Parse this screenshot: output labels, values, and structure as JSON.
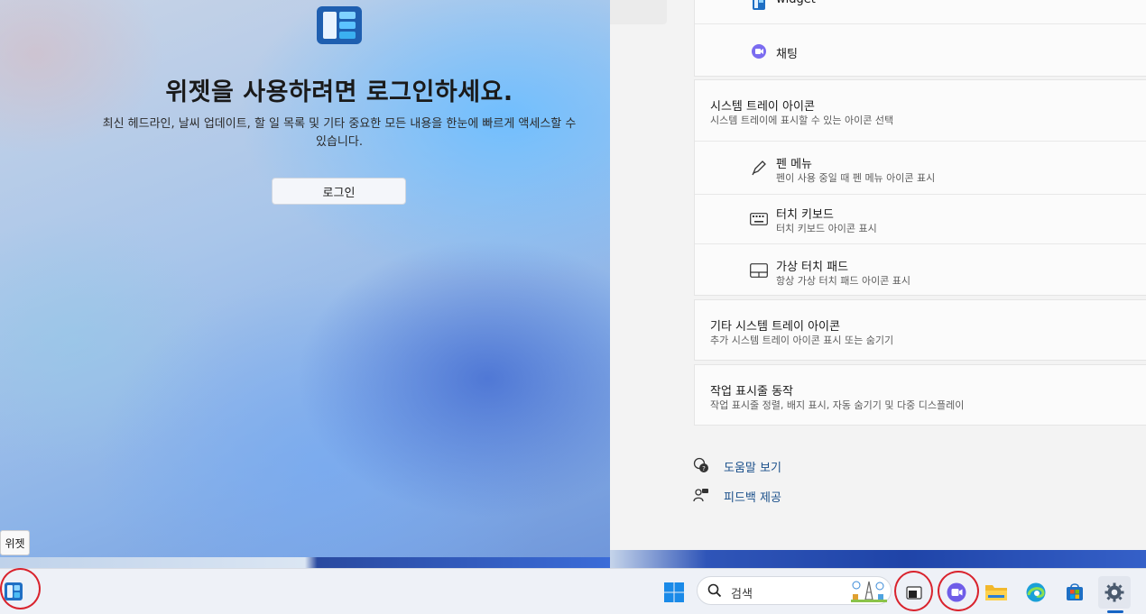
{
  "widgets": {
    "title": "위젯을 사용하려면 로그인하세요.",
    "description": "최신 헤드라인, 날씨 업데이트, 할 일 목록 및 기타 중요한 모든 내용을 한눈에 빠르게 액세스할 수 있습니다.",
    "signin_button": "로그인",
    "tooltip": "위젯"
  },
  "settings": {
    "taskbar_items": {
      "widget_label": "widget",
      "chat_label": "채팅"
    },
    "system_tray": {
      "title": "시스템 트레이 아이콘",
      "subtitle": "시스템 트레이에 표시할 수 있는 아이콘 선택",
      "items": [
        {
          "title": "펜 메뉴",
          "subtitle": "펜이 사용 중일 때 펜 메뉴 아이콘 표시"
        },
        {
          "title": "터치 키보드",
          "subtitle": "터치 키보드 아이콘 표시"
        },
        {
          "title": "가상 터치 패드",
          "subtitle": "항상 가상 터치 패드 아이콘 표시"
        }
      ]
    },
    "other_tray": {
      "title": "기타 시스템 트레이 아이콘",
      "subtitle": "추가 시스템 트레이 아이콘 표시 또는 숨기기"
    },
    "behaviors": {
      "title": "작업 표시줄 동작",
      "subtitle": "작업 표시줄 정렬, 배지 표시, 자동 숨기기 및 다중 디스플레이"
    },
    "links": {
      "help": "도움말 보기",
      "feedback": "피드백 제공"
    }
  },
  "taskbar": {
    "search_placeholder": "검색"
  },
  "colors": {
    "highlight_ring": "#d9232d",
    "link": "#1a4f8a",
    "accent": "#1664c4"
  }
}
